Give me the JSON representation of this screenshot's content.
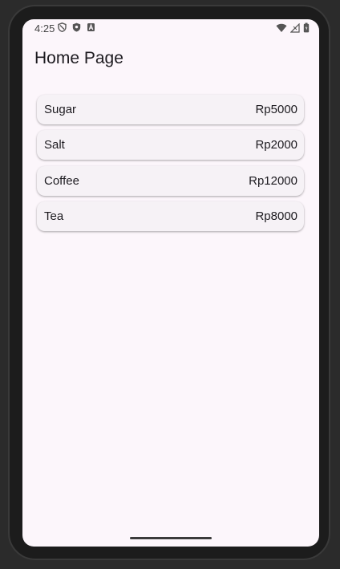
{
  "status_bar": {
    "time": "4:25",
    "left_icons": [
      "shield-outline-icon",
      "shield-filled-icon",
      "a-badge-icon"
    ],
    "right_icons": [
      "wifi-icon",
      "cell-signal-icon",
      "battery-icon"
    ]
  },
  "app_bar": {
    "title": "Home Page"
  },
  "items": [
    {
      "name": "Sugar",
      "price": "Rp5000"
    },
    {
      "name": "Salt",
      "price": "Rp2000"
    },
    {
      "name": "Coffee",
      "price": "Rp12000"
    },
    {
      "name": "Tea",
      "price": "Rp8000"
    }
  ],
  "colors": {
    "background": "#fcf6fb",
    "card": "#f6f2f6",
    "text": "#1d1b20"
  }
}
